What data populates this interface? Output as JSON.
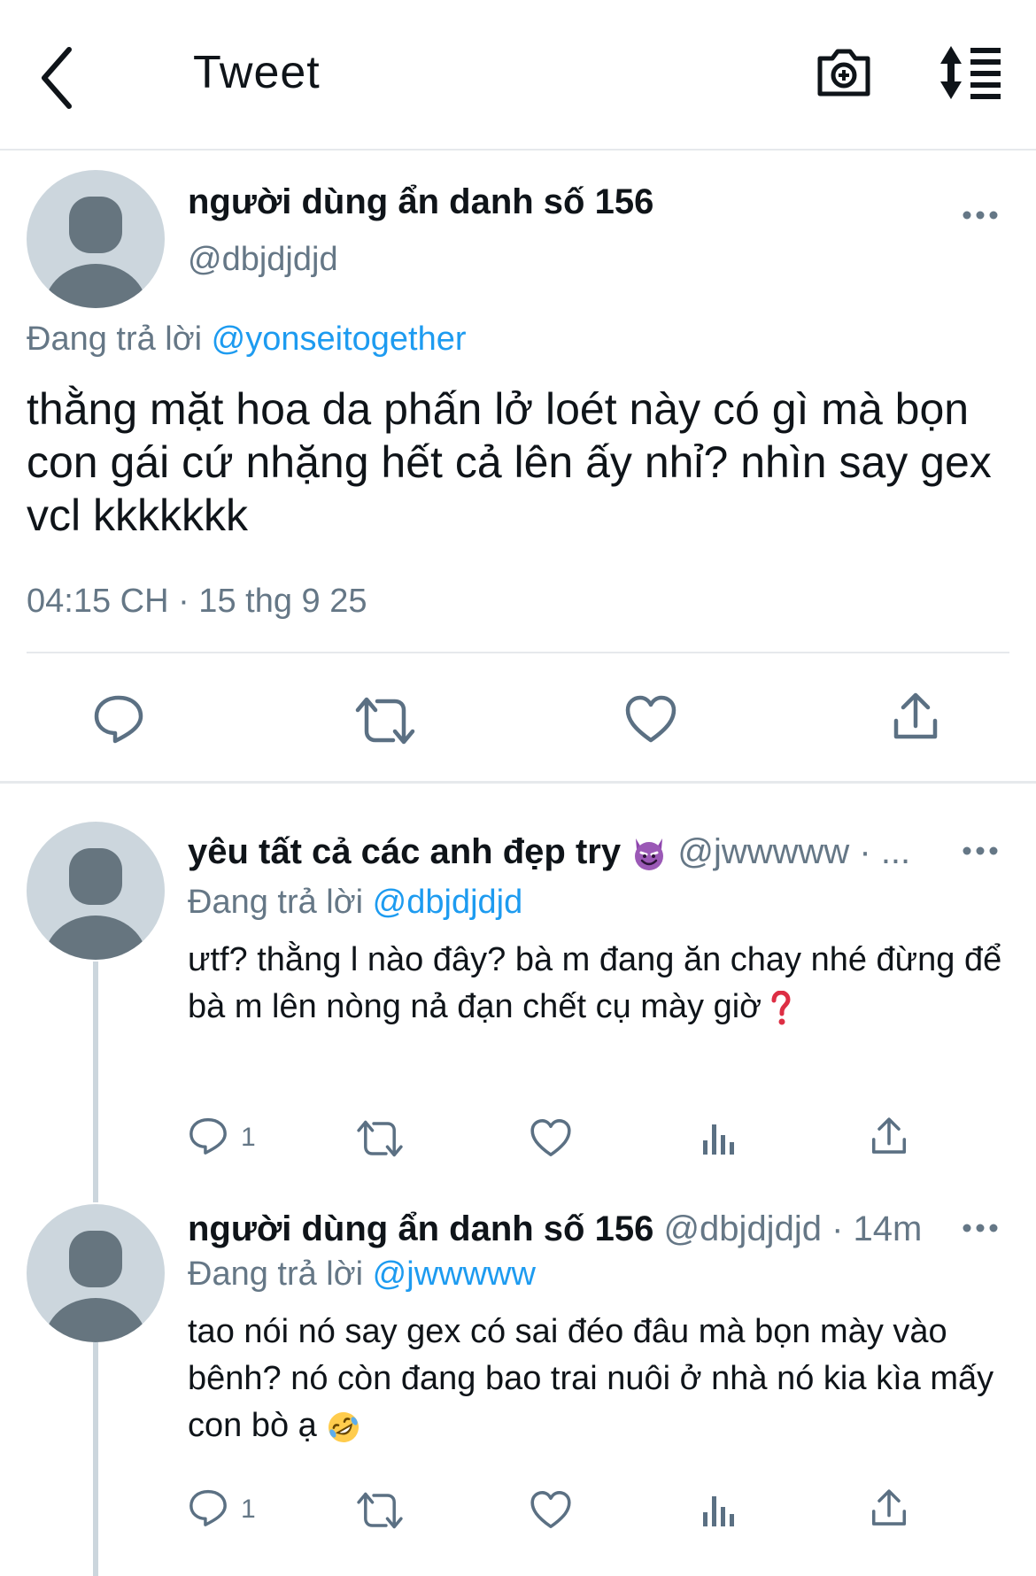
{
  "header": {
    "title": "Tweet"
  },
  "main_tweet": {
    "author_name": "người dùng ẩn danh số 156",
    "author_handle": "@dbjdjdjd",
    "replying_prefix": "Đang trả lời",
    "replying_to": "@yonseitogether",
    "text": "thằng mặt hoa da phấn lở loét này có gì mà bọn con gái cứ nhặng hết cả lên ấy nhỉ? nhìn say gex vcl kkkkkkk",
    "timestamp": "04:15 CH · 15 thg 9 25"
  },
  "replies": [
    {
      "author_name": "yêu tất cả các anh đẹp try",
      "author_handle": "@jwwwww · ...",
      "replying_prefix": "Đang trả lời",
      "replying_to": "@dbjdjdjd",
      "text": "ưtf? thằng l nào đây? bà m đang ăn chay nhé đừng để bà m lên nòng nả đạn chết cụ mày giờ",
      "reply_count": "1"
    },
    {
      "author_name": "người dùng ẩn danh số 156",
      "author_handle": "@dbjdjdjd · 14m",
      "replying_prefix": "Đang trả lời",
      "replying_to": "@jwwwww",
      "text": "tao nói nó say gex có sai đéo đâu mà bọn mày vào bênh? nó còn đang bao trai nuôi ở nhà nó kia kìa mấy con bò ạ",
      "reply_count": "1"
    }
  ],
  "colors": {
    "link": "#1d9bf0",
    "secondary_text": "#657786",
    "icon": "#5b7083",
    "avatar_bg": "#ccd6dd",
    "avatar_fg": "#66757f"
  }
}
